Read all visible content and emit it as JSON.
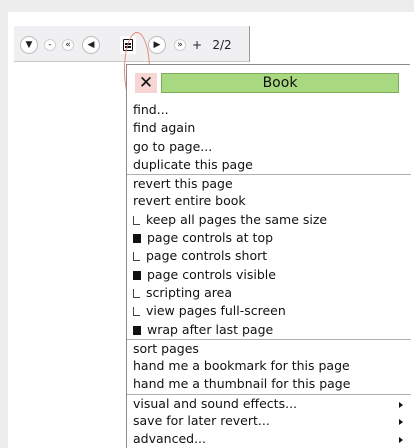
{
  "toolbar": {
    "buttons": [
      {
        "name": "menu-down",
        "glyph": "▼"
      },
      {
        "name": "first-page",
        "glyph": "-"
      },
      {
        "name": "back-fast",
        "glyph": "«"
      },
      {
        "name": "previous",
        "glyph": "◀"
      },
      {
        "name": "book-menu",
        "glyph": ""
      },
      {
        "name": "next",
        "glyph": "▶"
      },
      {
        "name": "forward-fast",
        "glyph": "»"
      },
      {
        "name": "add-page",
        "glyph": "+"
      }
    ],
    "page_indicator": "2/2"
  },
  "menu": {
    "title": "Book",
    "close_glyph": "✕",
    "items": [
      {
        "label": "find...",
        "type": "action"
      },
      {
        "label": "find again",
        "type": "action"
      },
      {
        "label": "go to page...",
        "type": "action"
      },
      {
        "label": "duplicate this page",
        "type": "action"
      },
      {
        "label": "revert this page",
        "type": "action",
        "separator_before": true
      },
      {
        "label": "revert entire book",
        "type": "action"
      },
      {
        "label": "keep all pages the same size",
        "type": "toggle",
        "checked": false
      },
      {
        "label": "page controls at top",
        "type": "toggle",
        "checked": true
      },
      {
        "label": "page controls short",
        "type": "toggle",
        "checked": false
      },
      {
        "label": "page controls visible",
        "type": "toggle",
        "checked": true
      },
      {
        "label": "scripting area",
        "type": "toggle",
        "checked": false
      },
      {
        "label": "view pages full-screen",
        "type": "toggle",
        "checked": false
      },
      {
        "label": "wrap after last page",
        "type": "toggle",
        "checked": true
      },
      {
        "label": "sort pages",
        "type": "action",
        "separator_before": true
      },
      {
        "label": "hand me a bookmark for this page",
        "type": "action"
      },
      {
        "label": "hand me a thumbnail for this page",
        "type": "action"
      },
      {
        "label": "visual and sound effects...",
        "type": "submenu",
        "separator_before": true
      },
      {
        "label": "save for later revert...",
        "type": "submenu"
      },
      {
        "label": "advanced...",
        "type": "submenu"
      }
    ]
  },
  "colors": {
    "title_bar": "#a8d87f",
    "close_button": "#f6d5d3",
    "highlight_ring": "#e48a7a",
    "toolbar_bg": "#f0f0f2"
  }
}
